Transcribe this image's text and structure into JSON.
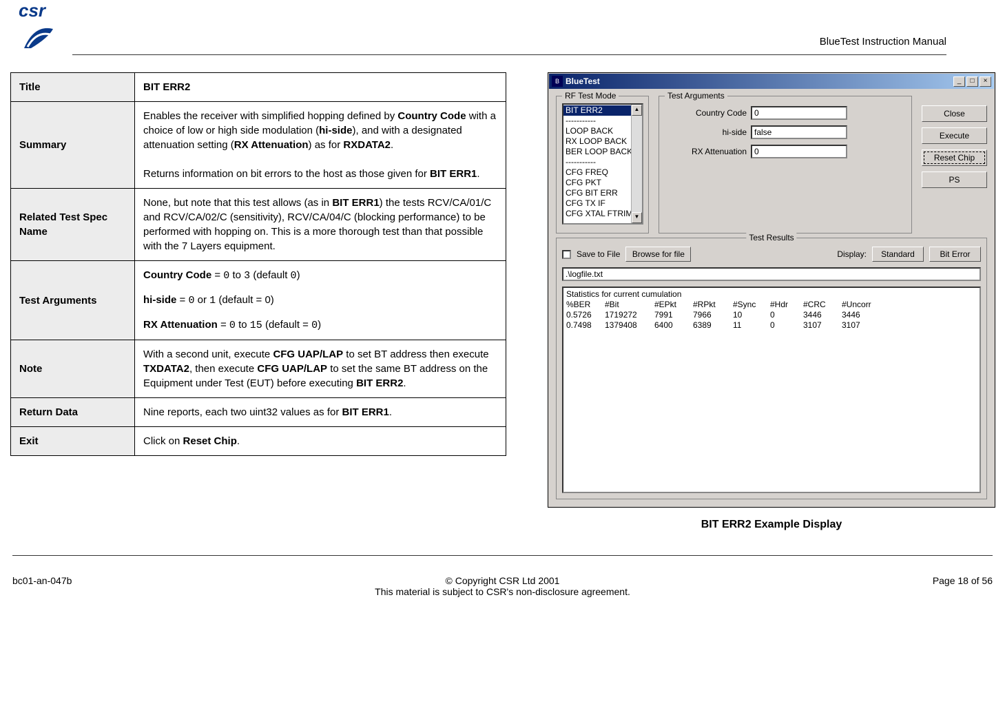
{
  "header": {
    "doc_title": "BlueTest Instruction Manual"
  },
  "table": {
    "title_label": "Title",
    "title_value": "BIT ERR2",
    "summary_label": "Summary",
    "summary_html": "Enables the receiver with simplified hopping defined by <b>Country Code</b> with a choice of low or high side modulation (<b>hi-side</b>), and with a designated attenuation setting  (<b>RX Attenuation</b>)  as for <b>RXDATA2</b>.<br><br>Returns information on bit errors to the host as those given for <b>BIT ERR1</b>.",
    "related_label": "Related Test Spec Name",
    "related_html": "None, but note that this test allows (as in <b>BIT ERR1</b>) the tests RCV/CA/01/C and RCV/CA/02/C (sensitivity), RCV/CA/04/C (blocking performance) to be performed with hopping on. This is a more thorough test than that possible with the 7 Layers equipment.",
    "args_label": "Test Arguments",
    "args_html": "<div class='para'><b>Country Code</b> = <span class='mono'>0</span> to <span class='mono'>3</span> (default  <span class='mono'>0</span>)</div><div class='para'><b>hi-side</b> = <span class='mono'>0</span> or <span class='mono'>1</span> (default = 0)</div><div><b>RX Attenuation</b> = <span class='mono'>0</span> to <span class='mono'>15</span>  (default = <span class='mono'>0</span>)</div>",
    "note_label": "Note",
    "note_html": "With a second unit, execute <b>CFG UAP/LAP</b>  to set BT address then execute <b>TXDATA2</b>, then execute <b>CFG UAP/LAP</b> to set the same BT address on the Equipment under Test (EUT) before executing <b>BIT ERR2</b>.",
    "return_label": "Return Data",
    "return_html": "Nine reports, each two uint32 values as for <b>BIT ERR1</b>.",
    "exit_label": "Exit",
    "exit_html": "Click on <b>Reset Chip</b>."
  },
  "app": {
    "title": "BlueTest",
    "rf_label": "RF Test Mode",
    "list": [
      "BIT ERR2",
      "-----------",
      "LOOP BACK",
      "RX LOOP BACK",
      "BER LOOP BACK",
      "-----------",
      "CFG FREQ",
      "CFG PKT",
      "CFG BIT ERR",
      "CFG TX IF",
      "CFG XTAL FTRIM"
    ],
    "args_label": "Test Arguments",
    "arg1_label": "Country Code",
    "arg1_value": "0",
    "arg2_label": "hi-side",
    "arg2_value": "false",
    "arg3_label": "RX Attenuation",
    "arg3_value": "0",
    "btn_close": "Close",
    "btn_execute": "Execute",
    "btn_reset": "Reset Chip",
    "btn_ps": "PS",
    "results_label": "Test Results",
    "save_label": "Save to File",
    "browse_label": "Browse for file",
    "display_label": "Display:",
    "btn_standard": "Standard",
    "btn_biterror": "Bit Error",
    "path_value": ".\\logfile.txt",
    "stats_title": "Statistics for current cumulation",
    "stats_hdr": [
      "%BER",
      "#Bit",
      "#EPkt",
      "#RPkt",
      "#Sync",
      "#Hdr",
      "#CRC",
      "#Uncorr"
    ],
    "stats_rows": [
      [
        "0.5726",
        "1719272",
        "7991",
        "7966",
        "10",
        "0",
        "3446",
        "3446"
      ],
      [
        "0.7498",
        "1379408",
        "6400",
        "6389",
        "11",
        "0",
        "3107",
        "3107"
      ]
    ]
  },
  "caption": "BIT ERR2 Example Display",
  "footer": {
    "left": "bc01-an-047b",
    "center1": "© Copyright CSR Ltd 2001",
    "center2": "This material is subject to CSR's non-disclosure agreement.",
    "right": "Page 18 of 56"
  }
}
